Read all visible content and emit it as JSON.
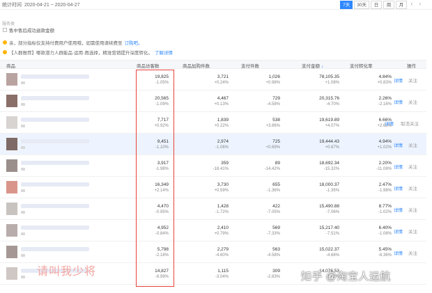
{
  "header": {
    "period_label": "统计时间",
    "period_range": "2020-04-21 ~ 2020-04-27",
    "ranges": [
      "7天",
      "30天",
      "日",
      "周",
      "月"
    ],
    "prev": "‹",
    "next": "›"
  },
  "filters": {
    "service_type": "服务类",
    "refund_label": "售中售后成功退款金额"
  },
  "notices": [
    {
      "text": "亲，部分指标仅支持付费用户使用哦，如需使用请续费至",
      "link": "订购吧。"
    },
    {
      "text": "【人群推荐】哪款潜力人群能品·运用·再选择，精准营销提升深度转化。",
      "link": "了解详情"
    }
  ],
  "table": {
    "columns": [
      "商品",
      "商品访客数",
      "商品加购件数",
      "支付件数",
      "支付金额",
      "支付转化率",
      "操作"
    ],
    "sort_icon": "↓",
    "actions": {
      "detail": "详情",
      "follow": "关注",
      "unfollow": "取消关注"
    },
    "rows": [
      {
        "visitors": "19,825",
        "vc": "-1.05%",
        "cart": "3,721",
        "cc": "+0.24%",
        "qty": "1,026",
        "qc": "+0.98%",
        "amount": "78,105.35",
        "ac": "+1.08%",
        "rate": "4.84%",
        "rc": "+0.83%",
        "follow": "关注",
        "color": "#b9a3a0"
      },
      {
        "visitors": "20,565",
        "vc": "-1.09%",
        "cart": "4,467",
        "cc": "+0.13%",
        "qty": "729",
        "qc": "-4.58%",
        "amount": "20,315.76",
        "ac": "-4.70%",
        "rate": "2.26%",
        "rc": "-2.16%",
        "follow": "关注",
        "color": "#8a6f68"
      },
      {
        "visitors": "7,717",
        "vc": "+0.92%",
        "cart": "1,839",
        "cc": "+0.22%",
        "qty": "538",
        "qc": "+3.86%",
        "amount": "19,619.89",
        "ac": "+4.07%",
        "rate": "6.66%",
        "rc": "+2.62%",
        "follow": "取消关注",
        "color": "#d8d4d2"
      },
      {
        "visitors": "9,451",
        "vc": "-1.10%",
        "cart": "2,974",
        "cc": "-1.06%",
        "qty": "725",
        "qc": "+0.69%",
        "amount": "19,444.43",
        "ac": "+0.67%",
        "rate": "4.94%",
        "rc": "+1.02%",
        "follow": "关注",
        "color": "#7e6a66"
      },
      {
        "visitors": "3,917",
        "vc": "-1.98%",
        "cart": "359",
        "cc": "-18.41%",
        "qty": "89",
        "qc": "-14.42%",
        "amount": "18,692.34",
        "ac": "-15.32%",
        "rate": "2.20%",
        "rc": "-11.08%",
        "follow": "关注",
        "color": "#9b8f8c"
      },
      {
        "visitors": "16,349",
        "vc": "+2.14%",
        "cart": "3,730",
        "cc": "+0.59%",
        "qty": "655",
        "qc": "-1.36%",
        "amount": "18,000.37",
        "ac": "-1.35%",
        "rate": "2.47%",
        "rc": "-1.98%",
        "follow": "关注",
        "color": "#d9958a"
      },
      {
        "visitors": "4,470",
        "vc": "-0.95%",
        "cart": "1,428",
        "cc": "-1.72%",
        "qty": "422",
        "qc": "-7.05%",
        "amount": "15,490.88",
        "ac": "-7.06%",
        "rate": "8.77%",
        "rc": "-1.02%",
        "follow": "关注",
        "color": "#c9c3c0"
      },
      {
        "visitors": "4,952",
        "vc": "-0.84%",
        "cart": "2,410",
        "cc": "+0.79%",
        "qty": "569",
        "qc": "-7.33%",
        "amount": "15,217.40",
        "ac": "-7.51%",
        "rate": "6.40%",
        "rc": "-1.08%",
        "follow": "关注",
        "color": "#b8adaa"
      },
      {
        "visitors": "5,798",
        "vc": "-2.18%",
        "cart": "2,279",
        "cc": "-4.60%",
        "qty": "563",
        "qc": "-4.58%",
        "amount": "15,022.37",
        "ac": "-4.68%",
        "rate": "5.45%",
        "rc": "-6.36%",
        "follow": "关注",
        "color": "#a59894"
      },
      {
        "visitors": "14,827",
        "vc": "-6.99%",
        "cart": "1,115",
        "cc": "-3.04%",
        "qty": "309",
        "qc": "-2.83%",
        "amount": "14,076.53",
        "ac": "-1.45%",
        "rate": "",
        "rc": "",
        "follow": "",
        "color": "#cfc7c4"
      }
    ]
  },
  "overlay_text": "请叫我少将",
  "watermark": "知乎 @淘宝人运航"
}
